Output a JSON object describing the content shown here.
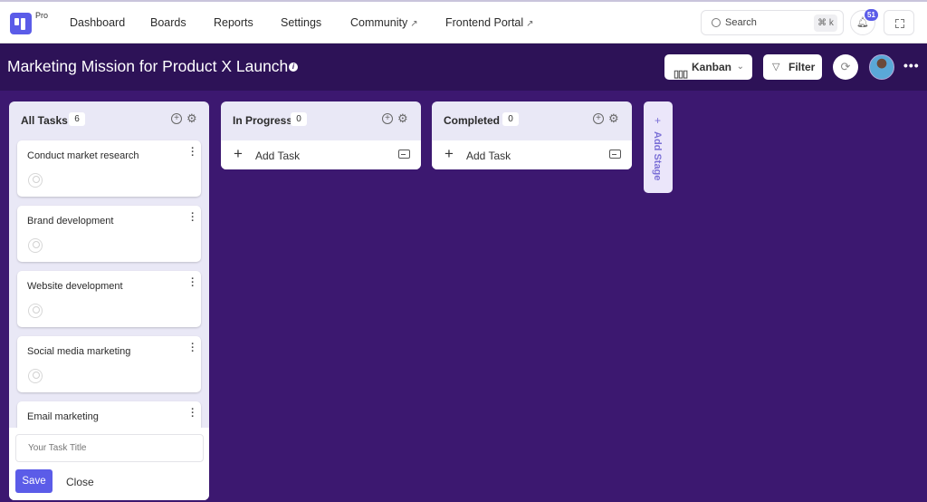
{
  "topnav": {
    "brand_tag": "Pro",
    "items": [
      {
        "label": "Dashboard",
        "external": false
      },
      {
        "label": "Boards",
        "external": false
      },
      {
        "label": "Reports",
        "external": false
      },
      {
        "label": "Settings",
        "external": false
      },
      {
        "label": "Community",
        "external": true
      },
      {
        "label": "Frontend Portal",
        "external": true
      }
    ],
    "external_glyph": "↗",
    "search": {
      "placeholder": "Search",
      "shortcut": "⌘ k"
    },
    "notifications": {
      "count": "51",
      "icon": "bell-icon"
    },
    "fullscreen_icon": "expand-icon"
  },
  "board": {
    "title": "Marketing Mission for Product X Launch",
    "info_glyph": "i",
    "view_select": {
      "label": "Kanban",
      "icon": "kanban-icon"
    },
    "filter_label": "Filter",
    "more_glyph": "•••"
  },
  "columns": [
    {
      "title": "All Tasks",
      "count": "6",
      "tasks": [
        {
          "title": "Conduct market research"
        },
        {
          "title": "Brand development"
        },
        {
          "title": "Website development"
        },
        {
          "title": "Social media marketing"
        },
        {
          "title": "Email marketing"
        }
      ],
      "quick_add": {
        "placeholder": "Your Task Title",
        "save_label": "Save",
        "close_label": "Close"
      }
    },
    {
      "title": "In Progress",
      "count": "0",
      "add_task_label": "Add Task"
    },
    {
      "title": "Completed",
      "count": "0",
      "add_task_label": "Add Task"
    }
  ],
  "add_stage": {
    "plus": "+",
    "label": "Add Stage"
  },
  "colors": {
    "accent": "#5b5ce8",
    "board_bg": "#3c1870",
    "header_bg": "#2d1257",
    "column_bg": "#e9e8f6"
  }
}
